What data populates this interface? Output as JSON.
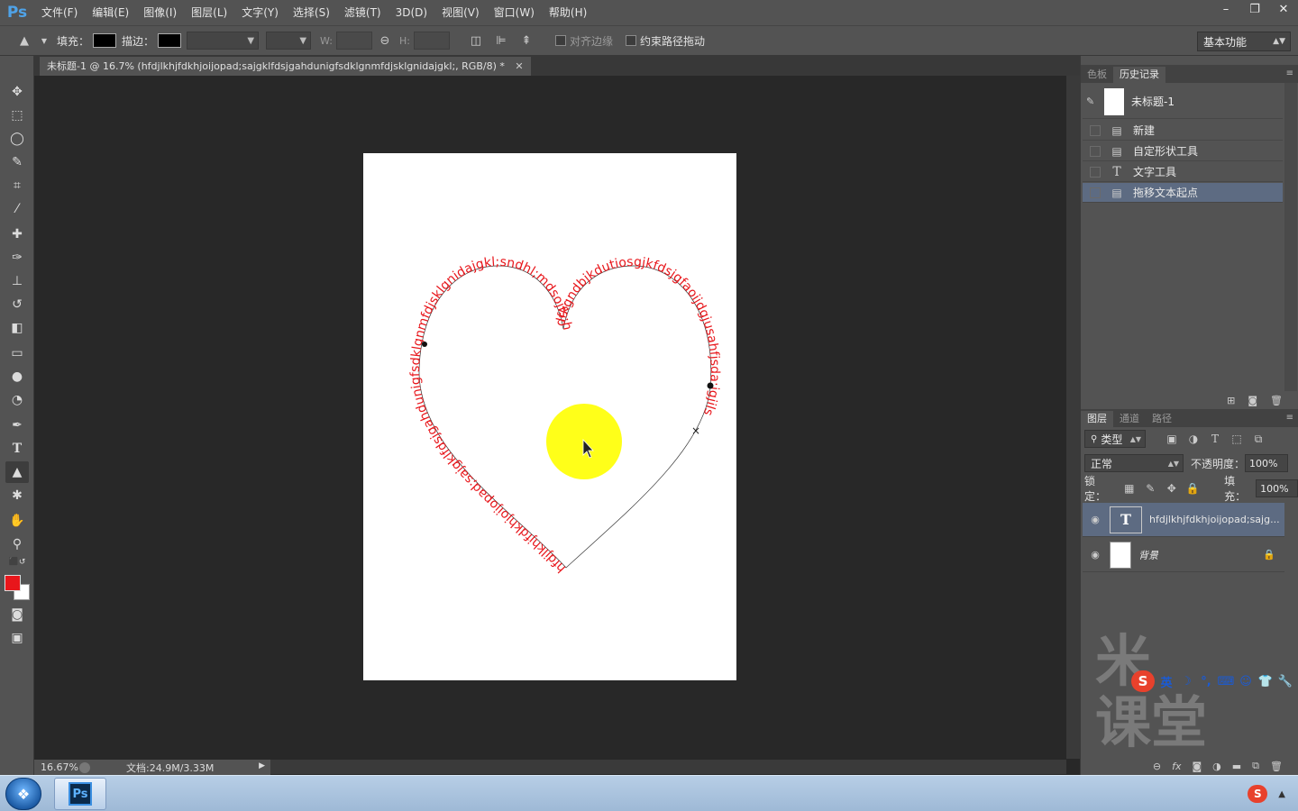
{
  "app": {
    "logo": "Ps"
  },
  "menu": [
    "文件(F)",
    "编辑(E)",
    "图像(I)",
    "图层(L)",
    "文字(Y)",
    "选择(S)",
    "滤镜(T)",
    "3D(D)",
    "视图(V)",
    "窗口(W)",
    "帮助(H)"
  ],
  "window_controls": [
    "–",
    "❐",
    "✕"
  ],
  "options": {
    "fill_label": "填充：",
    "stroke_label": "描边：",
    "w_label": "W:",
    "h_label": "H:",
    "align_edges_label": "对齐边缘",
    "constrain_path_label": "约束路径拖动",
    "workspace": "基本功能"
  },
  "document": {
    "tab_title": "未标题-1 @ 16.7% (hfdjlkhjfdkhjoijopad;sajgklfdsjgahdunigfsdklgnmfdjsklgnidajgkl;, RGB/8) *",
    "path_text": "hfdjlkhjfdkhjoijopad;sajgklfdsjgahdunigfsdklgnmfdjsklgnidajgkl;sndhl;mdsojfs:hdfkgndbjkdutiosgjkfdsjgfaoijdgjusahfjsda;igjils",
    "text_color": "#e8161b",
    "cursor_highlight": "#ffff00"
  },
  "status": {
    "zoom": "16.67%",
    "doc_size": "文档:24.9M/3.33M"
  },
  "colors": {
    "foreground": "#e8161b",
    "background": "#ffffff",
    "selection": "#5d6b82"
  },
  "history_panel": {
    "tabs": [
      "色板",
      "历史记录"
    ],
    "snapshot": "未标题-1",
    "items": [
      {
        "label": "新建",
        "icon": "doc-icon",
        "selected": false
      },
      {
        "label": "自定形状工具",
        "icon": "doc-icon",
        "selected": false
      },
      {
        "label": "文字工具",
        "icon": "text-icon",
        "selected": false
      },
      {
        "label": "拖移文本起点",
        "icon": "doc-icon",
        "selected": true
      }
    ]
  },
  "layers_panel": {
    "tabs": [
      "图层",
      "通道",
      "路径"
    ],
    "filter": "类型",
    "blend_mode": "正常",
    "opacity_label": "不透明度：",
    "opacity": "100%",
    "lock_label": "锁定：",
    "fill_label": "填充：",
    "fill": "100%",
    "layers": [
      {
        "name": "hfdjlkhjfdkhjoijopad;sajg...",
        "type": "text",
        "selected": true
      },
      {
        "name": "背景",
        "type": "image",
        "selected": false,
        "locked": true
      }
    ]
  },
  "ime": {
    "logo": "S",
    "lang": "英"
  },
  "watermark": {
    "line1": "米",
    "line2": "课堂"
  },
  "taskbar": {
    "ps_icon": "Ps",
    "tray_logo": "S"
  }
}
